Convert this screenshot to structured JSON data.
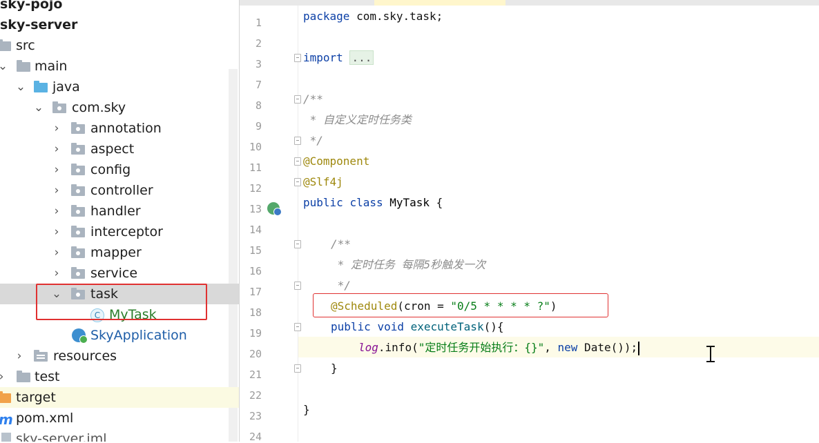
{
  "tree": {
    "items": [
      {
        "label": "sky-pojo"
      },
      {
        "label": "sky-server"
      },
      {
        "label": "src"
      },
      {
        "label": "main"
      },
      {
        "label": "java"
      },
      {
        "label": "com.sky"
      },
      {
        "label": "annotation"
      },
      {
        "label": "aspect"
      },
      {
        "label": "config"
      },
      {
        "label": "controller"
      },
      {
        "label": "handler"
      },
      {
        "label": "interceptor"
      },
      {
        "label": "mapper"
      },
      {
        "label": "service"
      },
      {
        "label": "task"
      },
      {
        "label": "MyTask"
      },
      {
        "label": "SkyApplication"
      },
      {
        "label": "resources"
      },
      {
        "label": "test"
      },
      {
        "label": "target"
      },
      {
        "label": "pom.xml"
      },
      {
        "label": "sky-server.iml"
      }
    ],
    "class_icon_letter": "C",
    "maven_icon_letter": "m"
  },
  "editor": {
    "line_numbers": [
      "1",
      "2",
      "3",
      "7",
      "8",
      "9",
      "10",
      "11",
      "12",
      "13",
      "14",
      "15",
      "16",
      "17",
      "18",
      "19",
      "20",
      "21",
      "22",
      "23",
      "24"
    ],
    "code": {
      "l1_kw": "package",
      "l1_rest": " com.sky.task;",
      "l3_kw": "import",
      "l3_dots": "...",
      "l8": "/**",
      "l9": " * 自定义定时任务类",
      "l10": " */",
      "l11": "@Component",
      "l12": "@Slf4j",
      "l13_kw1": "public",
      "l13_kw2": "class",
      "l13_name": "MyTask",
      "l13_brace": " {",
      "l15": "/**",
      "l16": " * 定时任务 每隔5秒触发一次",
      "l17": " */",
      "l18_ann": "@Scheduled",
      "l18_open": "(cron = ",
      "l18_str": "\"0/5 * * * * ?\"",
      "l18_close": ")",
      "l19_kw1": "public",
      "l19_kw2": "void",
      "l19_fn": "executeTask",
      "l19_rest": "(){",
      "l20_field": "log",
      "l20_call": ".info(",
      "l20_str": "\"定时任务开始执行：{}\"",
      "l20_comma": ", ",
      "l20_kw": "new",
      "l20_rest": " Date());",
      "l21": "}",
      "l23": "}"
    }
  }
}
